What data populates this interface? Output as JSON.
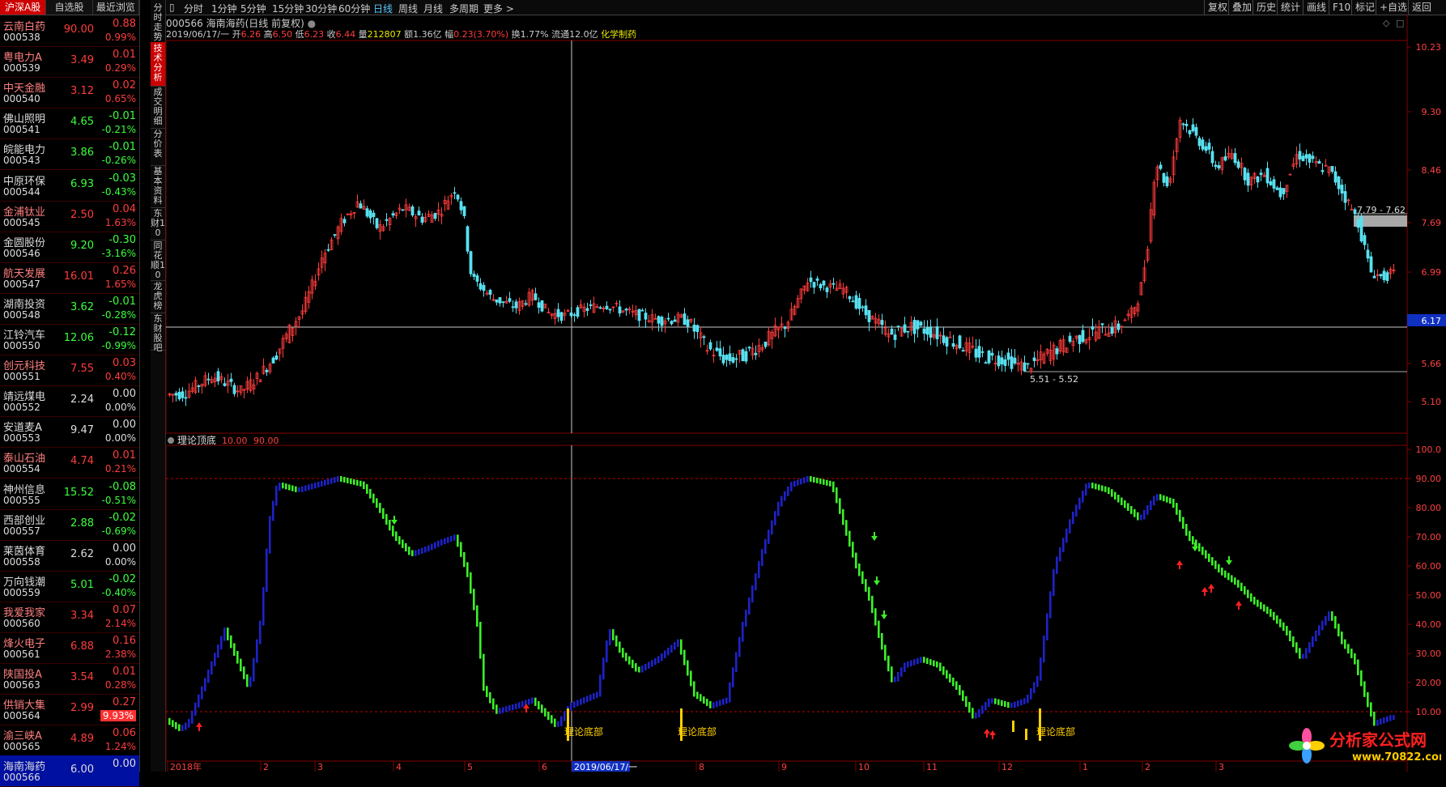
{
  "left_tabs": [
    "沪深A股",
    "自选股",
    "最近浏览"
  ],
  "stocks": [
    {
      "name": "云南白药",
      "code": "000538",
      "price": "90.00",
      "change": "0.88",
      "pct": "0.99%",
      "dir": "up"
    },
    {
      "name": "粤电力A",
      "code": "000539",
      "price": "3.49",
      "change": "0.01",
      "pct": "0.29%",
      "dir": "up"
    },
    {
      "name": "中天金融",
      "code": "000540",
      "price": "3.12",
      "change": "0.02",
      "pct": "0.65%",
      "dir": "up"
    },
    {
      "name": "佛山照明",
      "code": "000541",
      "price": "4.65",
      "change": "-0.01",
      "pct": "-0.21%",
      "dir": "dn"
    },
    {
      "name": "皖能电力",
      "code": "000543",
      "price": "3.86",
      "change": "-0.01",
      "pct": "-0.26%",
      "dir": "dn"
    },
    {
      "name": "中原环保",
      "code": "000544",
      "price": "6.93",
      "change": "-0.03",
      "pct": "-0.43%",
      "dir": "dn"
    },
    {
      "name": "金浦钛业",
      "code": "000545",
      "price": "2.50",
      "change": "0.04",
      "pct": "1.63%",
      "dir": "up"
    },
    {
      "name": "金圆股份",
      "code": "000546",
      "price": "9.20",
      "change": "-0.30",
      "pct": "-3.16%",
      "dir": "dn"
    },
    {
      "name": "航天发展",
      "code": "000547",
      "price": "16.01",
      "change": "0.26",
      "pct": "1.65%",
      "dir": "up"
    },
    {
      "name": "湖南投资",
      "code": "000548",
      "price": "3.62",
      "change": "-0.01",
      "pct": "-0.28%",
      "dir": "dn"
    },
    {
      "name": "江铃汽车",
      "code": "000550",
      "price": "12.06",
      "change": "-0.12",
      "pct": "-0.99%",
      "dir": "dn"
    },
    {
      "name": "创元科技",
      "code": "000551",
      "price": "7.55",
      "change": "0.03",
      "pct": "0.40%",
      "dir": "up"
    },
    {
      "name": "靖远煤电",
      "code": "000552",
      "price": "2.24",
      "change": "0.00",
      "pct": "0.00%",
      "dir": "fl"
    },
    {
      "name": "安道麦A",
      "code": "000553",
      "price": "9.47",
      "change": "0.00",
      "pct": "0.00%",
      "dir": "fl"
    },
    {
      "name": "泰山石油",
      "code": "000554",
      "price": "4.74",
      "change": "0.01",
      "pct": "0.21%",
      "dir": "up"
    },
    {
      "name": "神州信息",
      "code": "000555",
      "price": "15.52",
      "change": "-0.08",
      "pct": "-0.51%",
      "dir": "dn"
    },
    {
      "name": "西部创业",
      "code": "000557",
      "price": "2.88",
      "change": "-0.02",
      "pct": "-0.69%",
      "dir": "dn"
    },
    {
      "name": "莱茵体育",
      "code": "000558",
      "price": "2.62",
      "change": "0.00",
      "pct": "0.00%",
      "dir": "fl"
    },
    {
      "name": "万向钱潮",
      "code": "000559",
      "price": "5.01",
      "change": "-0.02",
      "pct": "-0.40%",
      "dir": "dn"
    },
    {
      "name": "我爱我家",
      "code": "000560",
      "price": "3.34",
      "change": "0.07",
      "pct": "2.14%",
      "dir": "up"
    },
    {
      "name": "烽火电子",
      "code": "000561",
      "price": "6.88",
      "change": "0.16",
      "pct": "2.38%",
      "dir": "up"
    },
    {
      "name": "陕国投A",
      "code": "000563",
      "price": "3.54",
      "change": "0.01",
      "pct": "0.28%",
      "dir": "up"
    },
    {
      "name": "供销大集",
      "code": "000564",
      "price": "2.99",
      "change": "0.27",
      "pct": "9.93%",
      "dir": "up"
    },
    {
      "name": "渝三峡A",
      "code": "000565",
      "price": "4.89",
      "change": "0.06",
      "pct": "1.24%",
      "dir": "up"
    },
    {
      "name": "海南海药",
      "code": "000566",
      "price": "6.00",
      "change": "0.00",
      "pct": "",
      "dir": "fl"
    }
  ],
  "vtabs": [
    "分时走势",
    "技术分析",
    "成交明细",
    "分价表",
    "基本资料",
    "东财10",
    "同花顺10",
    "龙虎榜",
    "东财股吧"
  ],
  "toolbar": {
    "periods": [
      "分时",
      "1分钟",
      "5分钟",
      "15分钟",
      "30分钟",
      "60分钟",
      "日线",
      "周线",
      "月线",
      "多周期",
      "更多 >"
    ],
    "active_period": "日线",
    "right": [
      "复权",
      "叠加",
      "历史",
      "统计",
      "画线",
      "F10",
      "标记",
      "+自选",
      "返回"
    ]
  },
  "info": {
    "title": "000566 海南海药(日线 前复权)",
    "date": "2019/06/17/一",
    "open_label": "开",
    "open": "6.26",
    "high_label": "高",
    "high": "6.50",
    "low_label": "低",
    "low": "6.23",
    "close_label": "收",
    "close": "6.44",
    "vol_label": "量",
    "vol": "212807",
    "amt_label": "额",
    "amt": "1.36亿",
    "chg_label": "幅",
    "chg": "0.23(3.70%)",
    "turn_label": "换",
    "turn": "1.77%",
    "float_label": "流通",
    "float": "12.0亿",
    "sector": "化学制药"
  },
  "main_axis": [
    "10.23",
    "9.30",
    "8.46",
    "7.69",
    "6.99",
    "6.17",
    "5.66",
    "5.10"
  ],
  "annot_high": "7.79 - 7.62",
  "annot_low": "5.51 - 5.52",
  "indicator": {
    "name": "理论顶底",
    "v1": "10.00",
    "v2": "90.00",
    "axis": [
      "100.0",
      "90.00",
      "80.00",
      "70.00",
      "60.00",
      "50.00",
      "40.00",
      "30.00",
      "20.00",
      "10.00"
    ],
    "label": "理论底部"
  },
  "time_axis": [
    "2018年",
    "2",
    "3",
    "4",
    "5",
    "6",
    "2019/06/17/一",
    "8",
    "9",
    "10",
    "11",
    "12",
    "1",
    "2",
    "3"
  ],
  "logo": {
    "text": "分析家公式网",
    "url": "www.70822.com"
  },
  "colors": {
    "up": "#ff3c3c",
    "down": "#58e0f0",
    "ind_blue": "#1e22c8",
    "ind_green": "#3cf028",
    "accent": "#c00000"
  }
}
